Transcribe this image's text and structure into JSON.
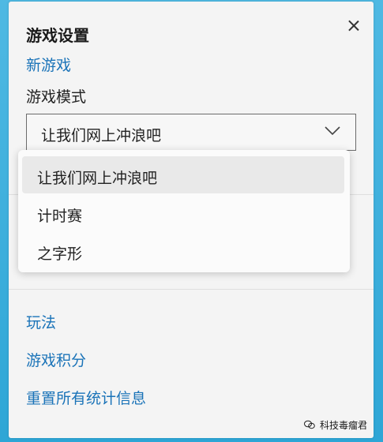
{
  "panel": {
    "title": "游戏设置",
    "new_game_link": "新游戏",
    "mode_label": "游戏模式",
    "selected_mode": "让我们网上冲浪吧",
    "options": [
      "让我们网上冲浪吧",
      "计时赛",
      "之字形"
    ],
    "links": [
      "玩法",
      "游戏积分",
      "重置所有统计信息"
    ]
  },
  "watermark": "科技毒瘤君",
  "icons": {
    "close": "close-icon",
    "chevron": "chevron-down-icon",
    "watermark": "wechat-icon"
  },
  "colors": {
    "link": "#1a73b8",
    "background": "#2ea6d6"
  }
}
